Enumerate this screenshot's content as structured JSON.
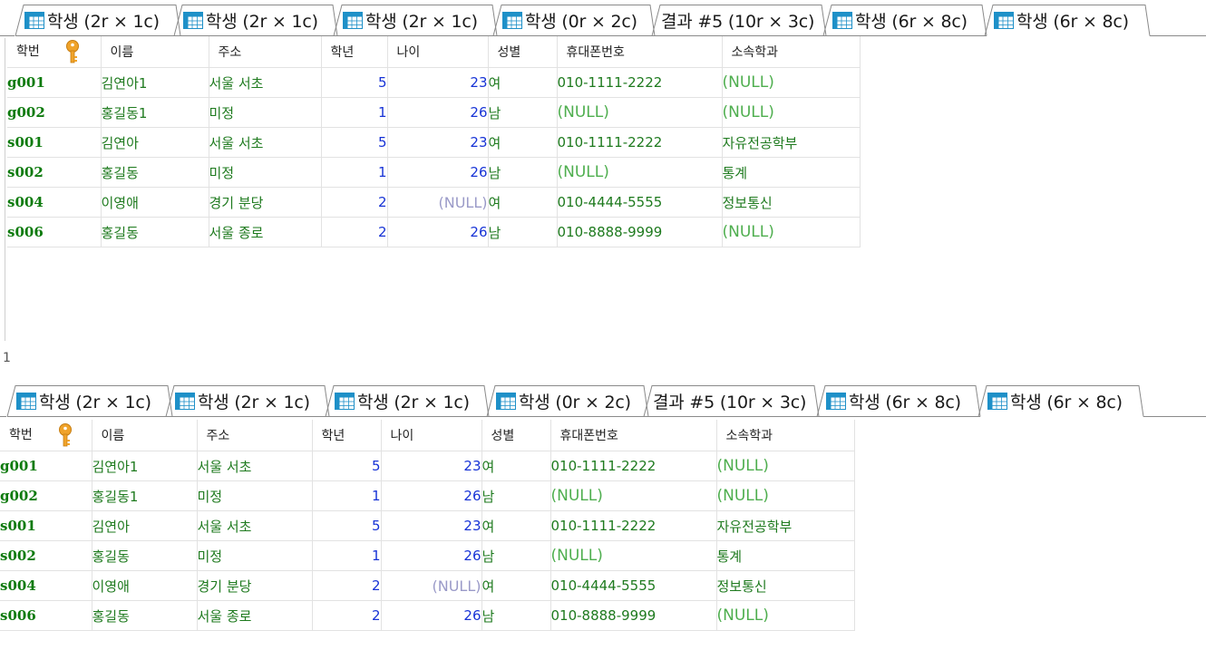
{
  "tabs": [
    {
      "label": "학생 (2r × 1c)",
      "icon": "table-icon"
    },
    {
      "label": "학생 (2r × 1c)",
      "icon": "table-icon"
    },
    {
      "label": "학생 (2r × 1c)",
      "icon": "table-icon"
    },
    {
      "label": "학생 (0r × 2c)",
      "icon": "table-icon"
    },
    {
      "label": "결과 #5 (10r × 3c)",
      "icon": null
    },
    {
      "label": "학생 (6r × 8c)",
      "icon": "table-icon"
    },
    {
      "label": "학생 (6r × 8c)",
      "icon": "table-icon"
    }
  ],
  "active_tab_index": 6,
  "columns": [
    "학번",
    "이름",
    "주소",
    "학년",
    "나이",
    "성별",
    "휴대폰번호",
    "소속학과"
  ],
  "primary_key_icon": "key-icon",
  "null_text": "(NULL)",
  "rows": [
    [
      "g001",
      "김연아1",
      "서울 서초",
      "5",
      "23",
      "여",
      "010-1111-2222",
      null
    ],
    [
      "g002",
      "홍길동1",
      "미정",
      "1",
      "26",
      "남",
      null,
      null
    ],
    [
      "s001",
      "김연아",
      "서울 서초",
      "5",
      "23",
      "여",
      "010-1111-2222",
      "자유전공학부"
    ],
    [
      "s002",
      "홍길동",
      "미정",
      "1",
      "26",
      "남",
      null,
      "통계"
    ],
    [
      "s004",
      "이영애",
      "경기 분당",
      "2",
      null,
      "여",
      "010-4444-5555",
      "정보통신"
    ],
    [
      "s006",
      "홍길동",
      "서울 종로",
      "2",
      "26",
      "남",
      "010-8888-9999",
      null
    ]
  ],
  "separator_label": "1",
  "colors": {
    "id": "#0d7a0d",
    "text": "#1e7a1e",
    "number": "#1733d6",
    "null_text": "#4eae4e",
    "null_number": "#9a9ac8",
    "table_icon": "#1e90c8"
  }
}
